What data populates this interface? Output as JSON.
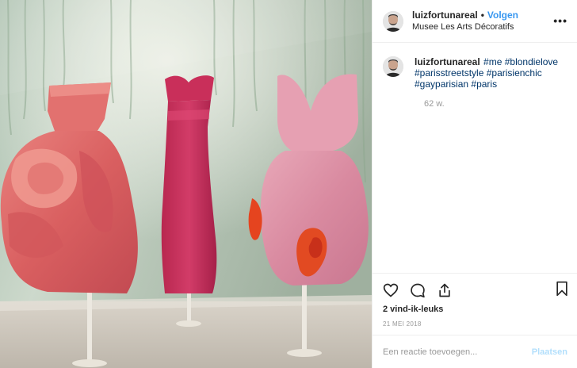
{
  "photo": {
    "alt_icon": "fashion-exhibit-photo"
  },
  "header": {
    "username": "luizfortunareal",
    "separator": "•",
    "follow_label": "Volgen",
    "location": "Musee Les Arts Décoratifs",
    "more_icon": "ellipsis-icon",
    "more_label": "•••"
  },
  "caption": {
    "username": "luizfortunareal",
    "tags": [
      "#me",
      "#blondielove",
      "#parisstreetstyle",
      "#parisienchic",
      "#gayparisian",
      "#paris"
    ],
    "age": "62 w."
  },
  "actions": {
    "icons": [
      "heart-icon",
      "comment-icon",
      "share-icon",
      "bookmark-icon"
    ],
    "likes": "2 vind-ik-leuks",
    "date": "21 MEI 2018"
  },
  "comment_box": {
    "placeholder": "Een reactie toevoegen...",
    "post_label": "Plaatsen"
  },
  "colors": {
    "link": "#3897f0",
    "hashtag": "#003569",
    "muted": "#999999",
    "post_disabled": "#b2dffc"
  }
}
